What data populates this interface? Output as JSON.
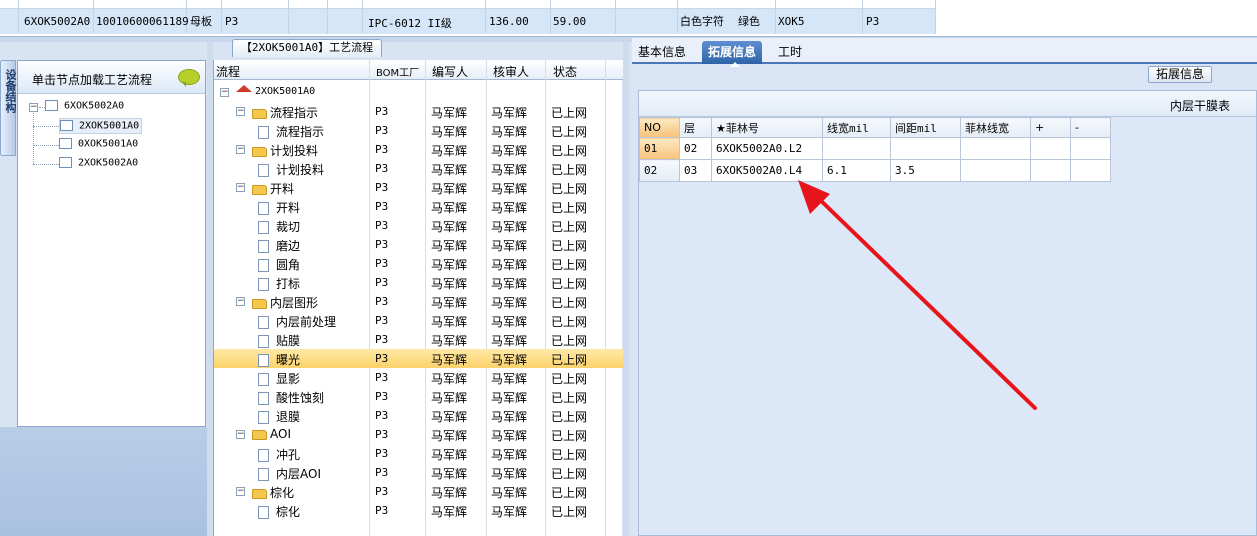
{
  "top_row": {
    "cells": [
      "6XOK5002A0",
      "10010600061189",
      "母板",
      "P3",
      "IPC-6012 II级",
      "136.00",
      "59.00",
      "白色字符",
      "绿色",
      "XOK5",
      "P3"
    ]
  },
  "left_panel": {
    "tab_label": "设备结构",
    "header": "单击节点加载工艺流程",
    "tree": {
      "root": "6XOK5002A0",
      "children": [
        "2XOK5001A0",
        "0XOK5001A0",
        "2XOK5002A0"
      ]
    }
  },
  "mid_panel": {
    "title": "【2XOK5001A0】工艺流程",
    "columns": [
      "流程",
      "BOM工厂",
      "编写人",
      "核审人",
      "状态"
    ],
    "root_node": "2XOK5001A0",
    "rows": [
      {
        "name": "流程指示",
        "level": 1,
        "bom": "P3",
        "writer": "马军辉",
        "reviewer": "马军辉",
        "status": "已上网"
      },
      {
        "name": "流程指示",
        "level": 2,
        "bom": "P3",
        "writer": "马军辉",
        "reviewer": "马军辉",
        "status": "已上网"
      },
      {
        "name": "计划投料",
        "level": 1,
        "bom": "P3",
        "writer": "马军辉",
        "reviewer": "马军辉",
        "status": "已上网"
      },
      {
        "name": "计划投料",
        "level": 2,
        "bom": "P3",
        "writer": "马军辉",
        "reviewer": "马军辉",
        "status": "已上网"
      },
      {
        "name": "开料",
        "level": 1,
        "bom": "P3",
        "writer": "马军辉",
        "reviewer": "马军辉",
        "status": "已上网"
      },
      {
        "name": "开料",
        "level": 2,
        "bom": "P3",
        "writer": "马军辉",
        "reviewer": "马军辉",
        "status": "已上网"
      },
      {
        "name": "裁切",
        "level": 2,
        "bom": "P3",
        "writer": "马军辉",
        "reviewer": "马军辉",
        "status": "已上网"
      },
      {
        "name": "磨边",
        "level": 2,
        "bom": "P3",
        "writer": "马军辉",
        "reviewer": "马军辉",
        "status": "已上网"
      },
      {
        "name": "圆角",
        "level": 2,
        "bom": "P3",
        "writer": "马军辉",
        "reviewer": "马军辉",
        "status": "已上网"
      },
      {
        "name": "打标",
        "level": 2,
        "bom": "P3",
        "writer": "马军辉",
        "reviewer": "马军辉",
        "status": "已上网"
      },
      {
        "name": "内层图形",
        "level": 1,
        "bom": "P3",
        "writer": "马军辉",
        "reviewer": "马军辉",
        "status": "已上网"
      },
      {
        "name": "内层前处理",
        "level": 2,
        "bom": "P3",
        "writer": "马军辉",
        "reviewer": "马军辉",
        "status": "已上网"
      },
      {
        "name": "贴膜",
        "level": 2,
        "bom": "P3",
        "writer": "马军辉",
        "reviewer": "马军辉",
        "status": "已上网"
      },
      {
        "name": "曝光",
        "level": 2,
        "bom": "P3",
        "writer": "马军辉",
        "reviewer": "马军辉",
        "status": "已上网",
        "selected": true
      },
      {
        "name": "显影",
        "level": 2,
        "bom": "P3",
        "writer": "马军辉",
        "reviewer": "马军辉",
        "status": "已上网"
      },
      {
        "name": "酸性蚀刻",
        "level": 2,
        "bom": "P3",
        "writer": "马军辉",
        "reviewer": "马军辉",
        "status": "已上网"
      },
      {
        "name": "退膜",
        "level": 2,
        "bom": "P3",
        "writer": "马军辉",
        "reviewer": "马军辉",
        "status": "已上网"
      },
      {
        "name": "AOI",
        "level": 1,
        "bom": "P3",
        "writer": "马军辉",
        "reviewer": "马军辉",
        "status": "已上网"
      },
      {
        "name": "冲孔",
        "level": 2,
        "bom": "P3",
        "writer": "马军辉",
        "reviewer": "马军辉",
        "status": "已上网"
      },
      {
        "name": "内层AOI",
        "level": 2,
        "bom": "P3",
        "writer": "马军辉",
        "reviewer": "马军辉",
        "status": "已上网"
      },
      {
        "name": "棕化",
        "level": 1,
        "bom": "P3",
        "writer": "马军辉",
        "reviewer": "马军辉",
        "status": "已上网"
      },
      {
        "name": "棕化",
        "level": 2,
        "bom": "P3",
        "writer": "马军辉",
        "reviewer": "马军辉",
        "status": "已上网"
      }
    ]
  },
  "right_panel": {
    "tabs": [
      "基本信息",
      "拓展信息",
      "工时"
    ],
    "active_tab": "拓展信息",
    "ext_button": "拓展信息",
    "grid_title": "内层干膜表",
    "grid_columns": [
      "NO",
      "层",
      "★菲林号",
      "线宽mil",
      "间距mil",
      "菲林线宽",
      "+",
      "-"
    ],
    "grid_rows": [
      [
        "01",
        "02",
        "6XOK5002A0.L2",
        "",
        "",
        "",
        "",
        ""
      ],
      [
        "02",
        "03",
        "6XOK5002A0.L4",
        "6.1",
        "3.5",
        "",
        "",
        ""
      ]
    ]
  },
  "colors": {
    "accent": "#2f63a8",
    "selected_row": "#fbd26a",
    "annotation_arrow": "#e8141c"
  }
}
